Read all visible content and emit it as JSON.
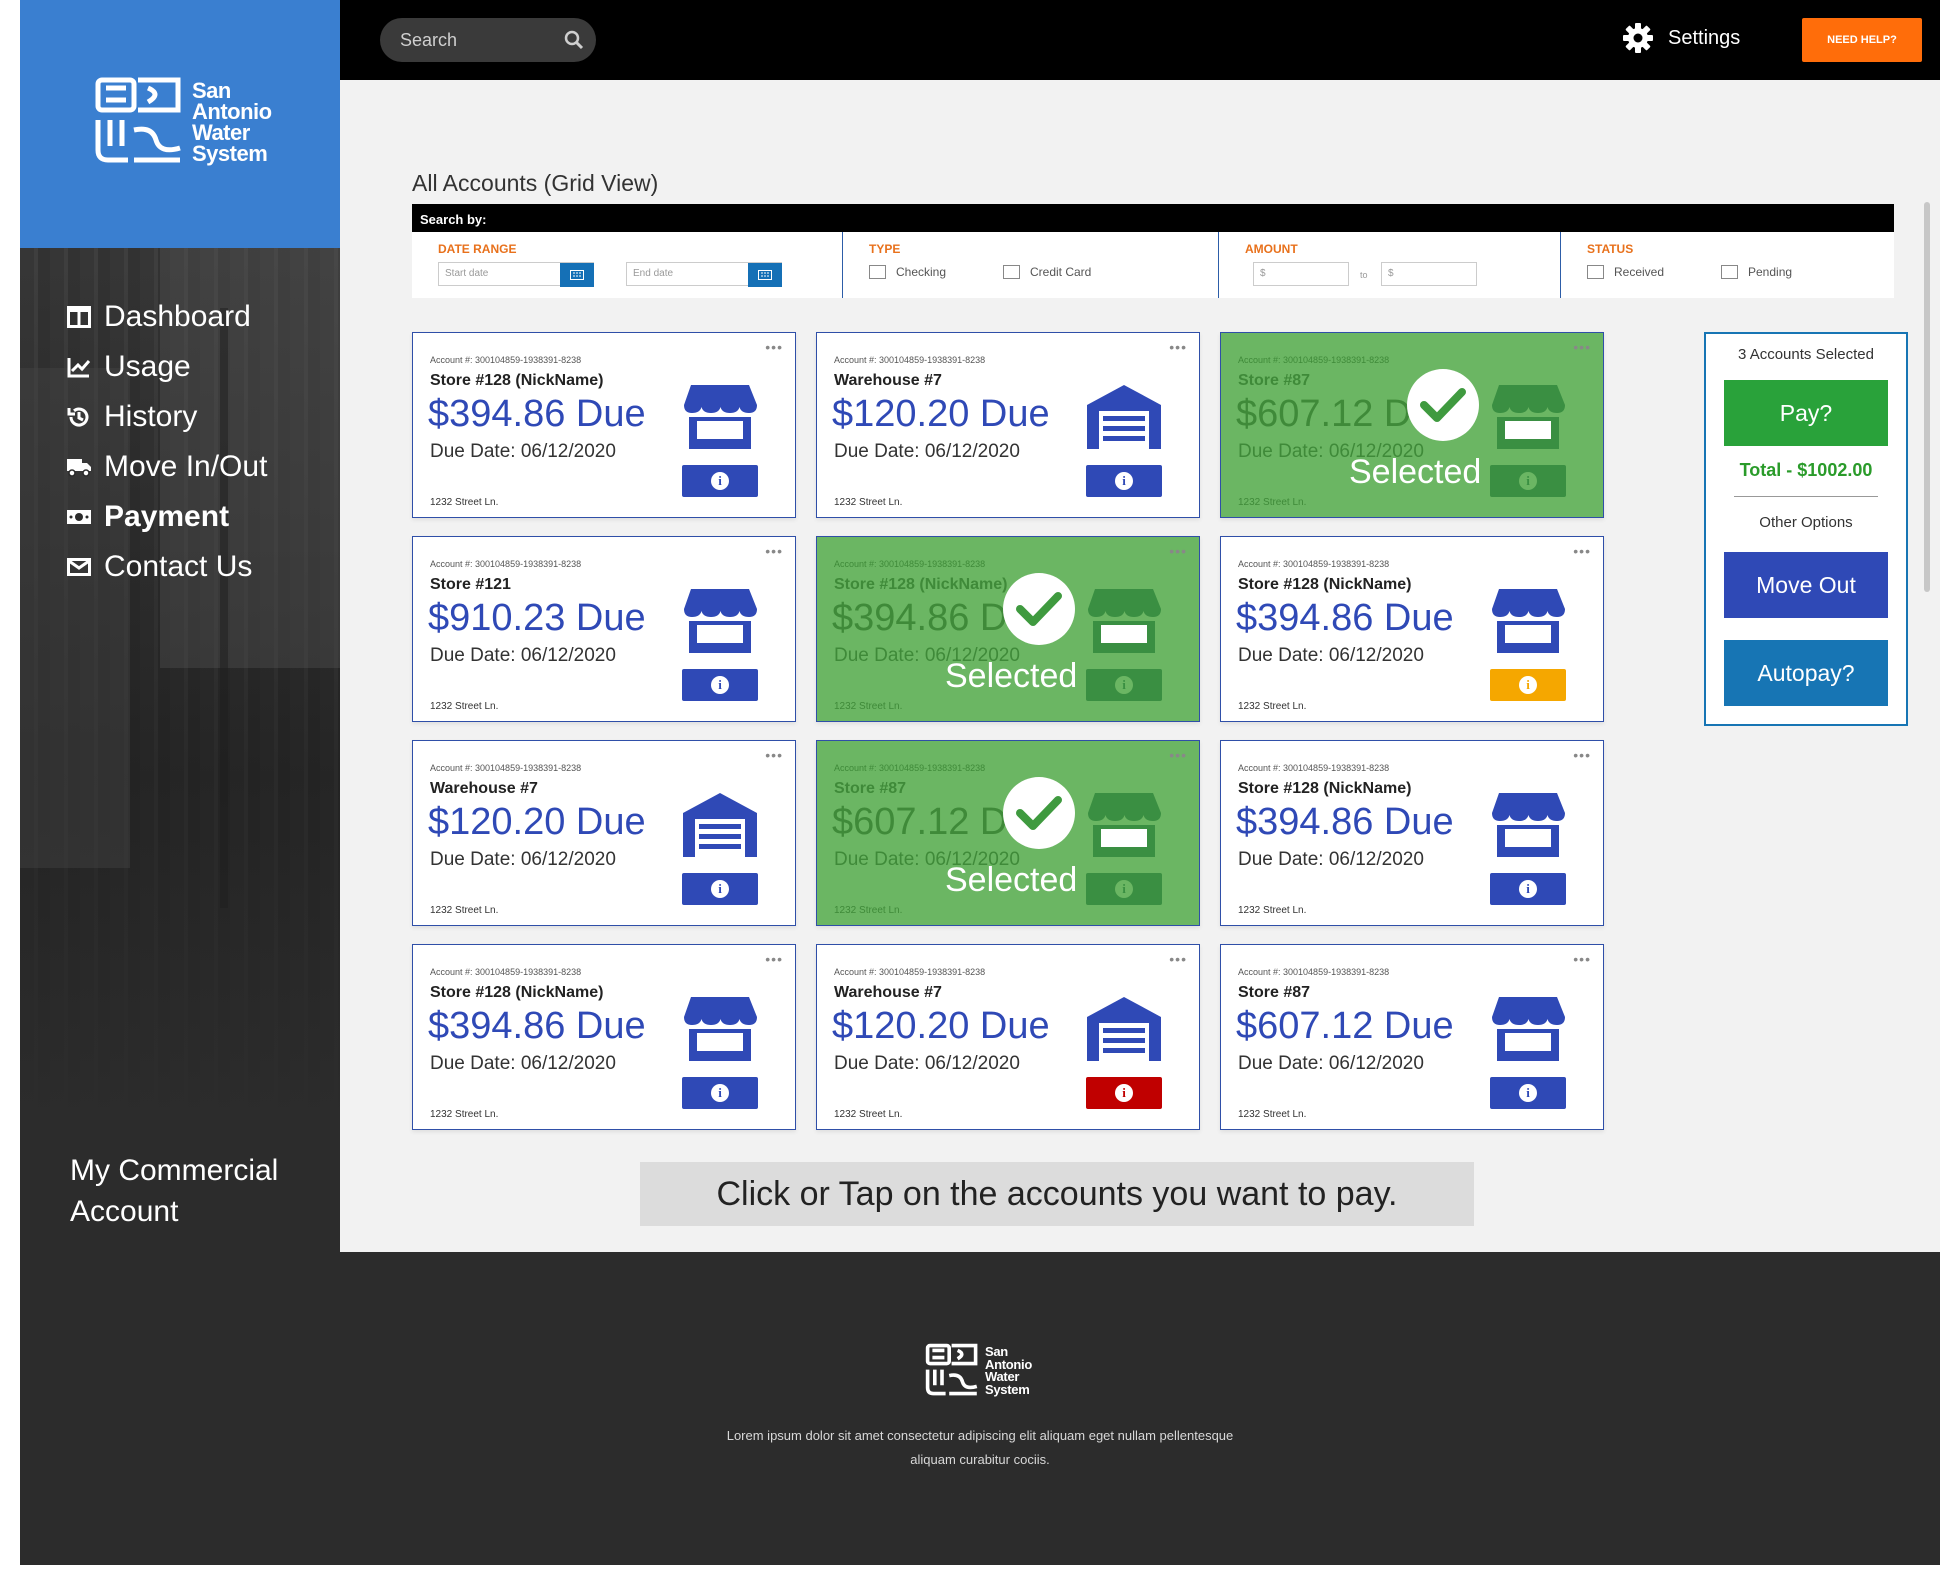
{
  "brand": {
    "logo_lines": [
      "San",
      "Antonio",
      "Water",
      "System"
    ]
  },
  "sidebar": {
    "items": [
      {
        "label": "Dashboard",
        "icon": "dashboard-icon"
      },
      {
        "label": "Usage",
        "icon": "chart-icon"
      },
      {
        "label": "History",
        "icon": "history-icon"
      },
      {
        "label": "Move In/Out",
        "icon": "truck-icon"
      },
      {
        "label": "Payment",
        "icon": "cash-icon",
        "active": true
      },
      {
        "label": "Contact Us",
        "icon": "envelope-icon"
      }
    ],
    "account_label": "My Commercial Account"
  },
  "topbar": {
    "search_placeholder": "Search",
    "settings_label": "Settings",
    "help_label": "NEED HELP?"
  },
  "page": {
    "title": "All Accounts (Grid View)"
  },
  "filters": {
    "search_by": "Search by:",
    "date_range": {
      "title": "DATE RANGE",
      "start_placeholder": "Start date",
      "end_placeholder": "End date"
    },
    "type": {
      "title": "TYPE",
      "options": [
        "Checking",
        "Credit Card"
      ]
    },
    "amount": {
      "title": "AMOUNT",
      "min_placeholder": "$",
      "to_label": "to",
      "max_placeholder": "$"
    },
    "status": {
      "title": "STATUS",
      "options": [
        "Received",
        "Pending"
      ]
    }
  },
  "accounts": [
    {
      "account": "Account #: 300104859-1938391-8238",
      "name": "Store #128 (NickName)",
      "amount": "$394.86 Due",
      "due_date": "Due Date: 06/12/2020",
      "address": "1232 Street Ln.",
      "icon": "store-icon",
      "selected": false,
      "info_color": "#2f49b6"
    },
    {
      "account": "Account #: 300104859-1938391-8238",
      "name": "Warehouse #7",
      "amount": "$120.20 Due",
      "due_date": "Due Date: 06/12/2020",
      "address": "1232 Street Ln.",
      "icon": "warehouse-icon",
      "selected": false,
      "info_color": "#2f49b6"
    },
    {
      "account": "Account #: 300104859-1938391-8238",
      "name": "Store #87",
      "amount": "$607.12 Due",
      "due_date": "Due Date: 06/12/2020",
      "address": "1232 Street Ln.",
      "icon": "store-icon",
      "selected": true,
      "info_color": "#2f49b6"
    },
    {
      "account": "Account #: 300104859-1938391-8238",
      "name": "Store #121",
      "amount": "$910.23 Due",
      "due_date": "Due Date: 06/12/2020",
      "address": "1232 Street Ln.",
      "icon": "store-icon",
      "selected": false,
      "info_color": "#2f49b6"
    },
    {
      "account": "Account #: 300104859-1938391-8238",
      "name": "Store #128 (NickName)",
      "amount": "$394.86 Due",
      "due_date": "Due Date: 06/12/2020",
      "address": "1232 Street Ln.",
      "icon": "store-icon",
      "selected": true,
      "info_color": "#2f49b6"
    },
    {
      "account": "Account #: 300104859-1938391-8238",
      "name": "Store #128 (NickName)",
      "amount": "$394.86 Due",
      "due_date": "Due Date: 06/12/2020",
      "address": "1232 Street Ln.",
      "icon": "store-icon",
      "selected": false,
      "info_color": "#f5a700"
    },
    {
      "account": "Account #: 300104859-1938391-8238",
      "name": "Warehouse #7",
      "amount": "$120.20 Due",
      "due_date": "Due Date: 06/12/2020",
      "address": "1232 Street Ln.",
      "icon": "warehouse-icon",
      "selected": false,
      "info_color": "#2f49b6"
    },
    {
      "account": "Account #: 300104859-1938391-8238",
      "name": "Store #87",
      "amount": "$607.12 Due",
      "due_date": "Due Date: 06/12/2020",
      "address": "1232 Street Ln.",
      "icon": "store-icon",
      "selected": true,
      "info_color": "#2f49b6"
    },
    {
      "account": "Account #: 300104859-1938391-8238",
      "name": "Store #128 (NickName)",
      "amount": "$394.86 Due",
      "due_date": "Due Date: 06/12/2020",
      "address": "1232 Street Ln.",
      "icon": "store-icon",
      "selected": false,
      "info_color": "#2f49b6"
    },
    {
      "account": "Account #: 300104859-1938391-8238",
      "name": "Store #128 (NickName)",
      "amount": "$394.86 Due",
      "due_date": "Due Date: 06/12/2020",
      "address": "1232 Street Ln.",
      "icon": "store-icon",
      "selected": false,
      "info_color": "#2f49b6"
    },
    {
      "account": "Account #: 300104859-1938391-8238",
      "name": "Warehouse #7",
      "amount": "$120.20 Due",
      "due_date": "Due Date: 06/12/2020",
      "address": "1232 Street Ln.",
      "icon": "warehouse-icon",
      "selected": false,
      "info_color": "#c00000"
    },
    {
      "account": "Account #: 300104859-1938391-8238",
      "name": "Store #87",
      "amount": "$607.12 Due",
      "due_date": "Due Date: 06/12/2020",
      "address": "1232 Street Ln.",
      "icon": "store-icon",
      "selected": false,
      "info_color": "#2f49b6"
    }
  ],
  "selected_overlay_label": "Selected",
  "summary": {
    "count_label": "3 Accounts Selected",
    "pay_label": "Pay?",
    "total_label": "Total - $1002.00",
    "other_label": "Other Options",
    "move_out_label": "Move Out",
    "autopay_label": "Autopay?"
  },
  "instruction": "Click or Tap on the accounts you want to pay.",
  "footer": {
    "logo_lines": [
      "San",
      "Antonio",
      "Water",
      "System"
    ],
    "text_line1": "Lorem ipsum dolor sit amet consectetur adipiscing elit aliquam eget nullam pellentesque",
    "text_line2": "aliquam curabitur cociis."
  },
  "colors": {
    "accent_blue": "#2f49b6",
    "selected_green": "#6bb663",
    "pay_green": "#29a23a",
    "autopay_blue": "#1775b4",
    "help_orange": "#ff6d0a",
    "logo_blue": "#3a7fd0"
  }
}
